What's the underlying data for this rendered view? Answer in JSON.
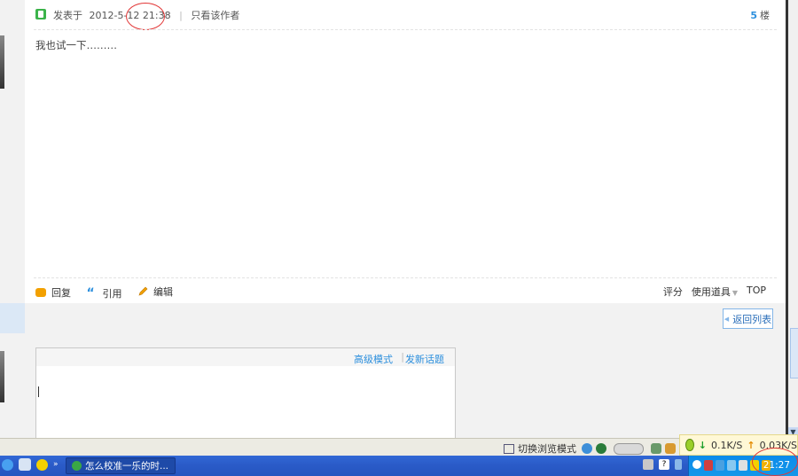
{
  "post": {
    "posted_prefix": "发表于",
    "posted_date": "2012-5-12 21:38",
    "separator": "|",
    "author_only": "只看该作者",
    "floor_number": "5",
    "floor_label": "楼",
    "content": "我也试一下………"
  },
  "actions": {
    "reply": "回复",
    "quote": "引用",
    "edit": "编辑"
  },
  "tools": {
    "rate": "评分",
    "use_item": "使用道具",
    "top": "TOP"
  },
  "back_to_list": "返回列表",
  "reply_box": {
    "advanced_mode": "高级模式",
    "separator": "|",
    "new_topic": "发新话题"
  },
  "statusbar": {
    "switch_mode": "切换浏览模式",
    "down_speed": "0.1K/S",
    "up_speed": "0.03K/S"
  },
  "taskbar": {
    "chevron": "»",
    "task_title": "怎么校准一乐的时...",
    "clock": "21:27"
  },
  "colors": {
    "link": "#2c8fdd",
    "taskbar": "#2a5ac7",
    "tray": "#0d8bea",
    "annotation": "#e23636"
  }
}
